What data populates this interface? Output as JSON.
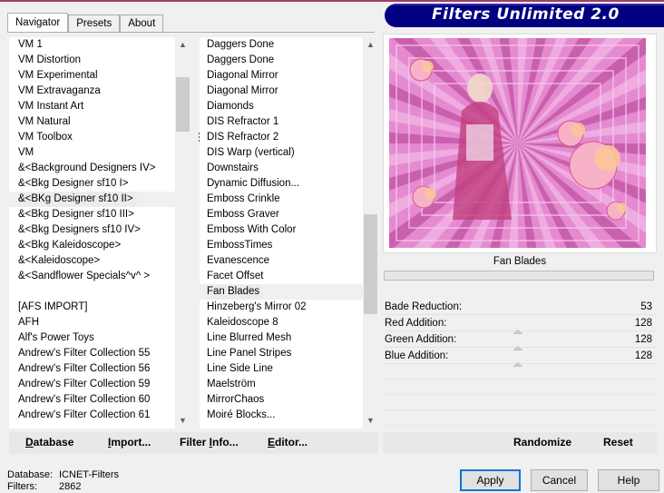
{
  "tabs": [
    "Navigator",
    "Presets",
    "About"
  ],
  "banner": "Filters Unlimited 2.0",
  "categories": [
    {
      "label": "VM 1"
    },
    {
      "label": "VM Distortion"
    },
    {
      "label": "VM Experimental"
    },
    {
      "label": "VM Extravaganza"
    },
    {
      "label": "VM Instant Art"
    },
    {
      "label": "VM Natural"
    },
    {
      "label": "VM Toolbox"
    },
    {
      "label": "VM"
    },
    {
      "label": "&<Background Designers IV>"
    },
    {
      "label": "&<Bkg Designer sf10 I>"
    },
    {
      "label": "&<BKg Designer sf10 II>",
      "selected": true
    },
    {
      "label": "&<Bkg Designer sf10 III>"
    },
    {
      "label": "&<Bkg Designers sf10 IV>"
    },
    {
      "label": "&<Bkg Kaleidoscope>"
    },
    {
      "label": "&<Kaleidoscope>"
    },
    {
      "label": "&<Sandflower Specials^v^ >"
    },
    {
      "label": ""
    },
    {
      "label": "[AFS IMPORT]"
    },
    {
      "label": "AFH"
    },
    {
      "label": "Alf's Power Toys"
    },
    {
      "label": "Andrew's Filter Collection 55"
    },
    {
      "label": "Andrew's Filter Collection 56"
    },
    {
      "label": "Andrew's Filter Collection 59"
    },
    {
      "label": "Andrew's Filter Collection 60"
    },
    {
      "label": "Andrew's Filter Collection 61"
    }
  ],
  "filters": [
    {
      "label": "Daggers Done"
    },
    {
      "label": "Daggers Done"
    },
    {
      "label": "Diagonal Mirror"
    },
    {
      "label": "Diagonal Mirror"
    },
    {
      "label": "Diamonds"
    },
    {
      "label": "DIS Refractor 1"
    },
    {
      "label": "DIS Refractor 2"
    },
    {
      "label": "DIS Warp (vertical)"
    },
    {
      "label": "Downstairs"
    },
    {
      "label": "Dynamic Diffusion..."
    },
    {
      "label": "Emboss Crinkle"
    },
    {
      "label": "Emboss Graver"
    },
    {
      "label": "Emboss With Color"
    },
    {
      "label": "EmbossTimes"
    },
    {
      "label": "Evanescence"
    },
    {
      "label": "Facet Offset"
    },
    {
      "label": "Fan Blades",
      "selected": true
    },
    {
      "label": "Hinzeberg's Mirror 02"
    },
    {
      "label": "Kaleidoscope 8"
    },
    {
      "label": "Line Blurred Mesh"
    },
    {
      "label": "Line Panel Stripes"
    },
    {
      "label": "Line Side Line"
    },
    {
      "label": "Maelström"
    },
    {
      "label": "MirrorChaos"
    },
    {
      "label": "Moiré Blocks..."
    }
  ],
  "scroll": {
    "categories_fraction": 0.08,
    "filters_fraction": 0.62
  },
  "preview": {
    "filter_name": "Fan Blades",
    "colors": {
      "base": "#e58ad0",
      "light": "#f6c8ec",
      "dark": "#b23e92"
    }
  },
  "params": [
    {
      "label": "Bade Reduction:",
      "value": "53"
    },
    {
      "label": "Red Addition:",
      "value": "128"
    },
    {
      "label": "Green Addition:",
      "value": "128"
    },
    {
      "label": "Blue Addition:",
      "value": "128"
    }
  ],
  "bottom": {
    "database_label": "Database",
    "import_label": "Import...",
    "filter_info_label": "Filter Info...",
    "editor_label": "Editor...",
    "randomize_label": "Randomize",
    "reset_label": "Reset"
  },
  "status": {
    "database_key": "Database:",
    "database_value": "ICNET-Filters",
    "filters_key": "Filters:",
    "filters_value": "2862"
  },
  "buttons": {
    "apply": "Apply",
    "cancel": "Cancel",
    "help": "Help"
  }
}
